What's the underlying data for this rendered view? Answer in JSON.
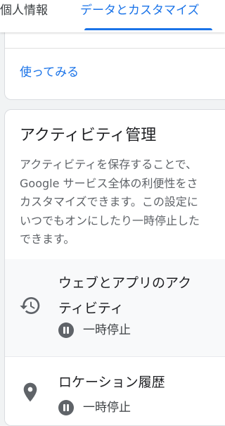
{
  "tabs": [
    {
      "label": "個人情報"
    },
    {
      "label": "データとカスタマイズ"
    }
  ],
  "top_card": {
    "link_label": "使ってみる"
  },
  "activity": {
    "title": "アクティビティ管理",
    "description": "アクティビティを保存することで、\nGoogle サービス全体の利便性をさ\nカスタマイズできます。この設定に\nいつでもオンにしたり一時停止した\nできます。",
    "items": [
      {
        "title": "ウェブとアプリのアク\nティビティ",
        "status": "一時停止",
        "icon": "history-icon"
      },
      {
        "title": "ロケーション履歴",
        "status": "一時停止",
        "icon": "location-pin-icon"
      }
    ]
  },
  "colors": {
    "accent": "#1a73e8",
    "icon": "#5f6368"
  }
}
